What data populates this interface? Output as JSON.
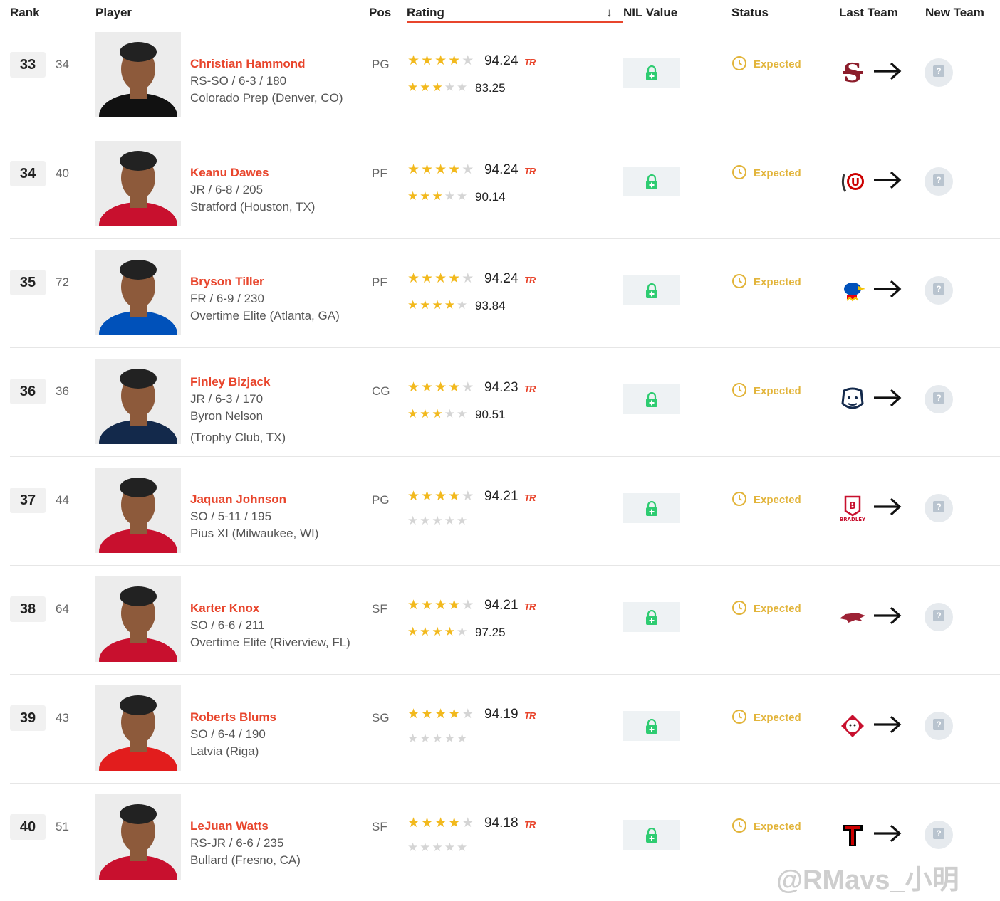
{
  "header": {
    "rank": "Rank",
    "player": "Player",
    "pos": "Pos",
    "rating": "Rating",
    "sort_arrow": "↓",
    "nil": "NIL Value",
    "status": "Status",
    "last_team": "Last Team",
    "new_team": "New Team"
  },
  "colors": {
    "accent": "#e8452c",
    "star": "#f2b91d",
    "status": "#e2b43a",
    "lock": "#2ecc71"
  },
  "rows": [
    {
      "rank": "33",
      "prev": "34",
      "name": "Christian Hammond",
      "info1": "RS-SO / 6-3 / 180",
      "info2": "Colorado Prep (Denver, CO)",
      "info3": "",
      "pos": "PG",
      "tr_stars": 4,
      "tr_score": "94.24",
      "tr_label": "TR",
      "hs_stars": 3,
      "hs_score": "83.25",
      "status": "Expected",
      "last_team_icon": "santa-clara-logo",
      "new_team_icon": "unknown-team-icon"
    },
    {
      "rank": "34",
      "prev": "40",
      "name": "Keanu Dawes",
      "info1": "JR / 6-8 / 205",
      "info2": "Stratford (Houston, TX)",
      "info3": "",
      "pos": "PF",
      "tr_stars": 4,
      "tr_score": "94.24",
      "tr_label": "TR",
      "hs_stars": 3,
      "hs_score": "90.14",
      "status": "Expected",
      "last_team_icon": "utah-logo",
      "new_team_icon": "unknown-team-icon"
    },
    {
      "rank": "35",
      "prev": "72",
      "name": "Bryson Tiller",
      "info1": "FR / 6-9 / 230",
      "info2": "Overtime Elite (Atlanta, GA)",
      "info3": "",
      "pos": "PF",
      "tr_stars": 4,
      "tr_score": "94.24",
      "tr_label": "TR",
      "hs_stars": 4,
      "hs_score": "93.84",
      "status": "Expected",
      "last_team_icon": "kansas-logo",
      "new_team_icon": "unknown-team-icon"
    },
    {
      "rank": "36",
      "prev": "36",
      "name": "Finley Bizjack",
      "info1": "JR / 6-3 / 170",
      "info2": "Byron Nelson",
      "info3": "(Trophy Club, TX)",
      "pos": "CG",
      "tr_stars": 4,
      "tr_score": "94.23",
      "tr_label": "TR",
      "hs_stars": 3,
      "hs_score": "90.51",
      "status": "Expected",
      "last_team_icon": "butler-logo",
      "new_team_icon": "unknown-team-icon"
    },
    {
      "rank": "37",
      "prev": "44",
      "name": "Jaquan Johnson",
      "info1": "SO / 5-11 / 195",
      "info2": "Pius XI (Milwaukee, WI)",
      "info3": "",
      "pos": "PG",
      "tr_stars": 4,
      "tr_score": "94.21",
      "tr_label": "TR",
      "hs_stars": 0,
      "hs_score": "",
      "status": "Expected",
      "last_team_icon": "bradley-logo",
      "new_team_icon": "unknown-team-icon"
    },
    {
      "rank": "38",
      "prev": "64",
      "name": "Karter Knox",
      "info1": "SO / 6-6 / 211",
      "info2": "Overtime Elite (Riverview, FL)",
      "info3": "",
      "pos": "SF",
      "tr_stars": 4,
      "tr_score": "94.21",
      "tr_label": "TR",
      "hs_stars": 4,
      "hs_score": "97.25",
      "status": "Expected",
      "last_team_icon": "arkansas-logo",
      "new_team_icon": "unknown-team-icon"
    },
    {
      "rank": "39",
      "prev": "43",
      "name": "Roberts Blums",
      "info1": "SO / 6-4 / 190",
      "info2": "Latvia (Riga)",
      "info3": "",
      "pos": "SG",
      "tr_stars": 4,
      "tr_score": "94.19",
      "tr_label": "TR",
      "hs_stars": 0,
      "hs_score": "",
      "status": "Expected",
      "last_team_icon": "davidson-logo",
      "new_team_icon": "unknown-team-icon"
    },
    {
      "rank": "40",
      "prev": "51",
      "name": "LeJuan Watts",
      "info1": "RS-JR / 6-6 / 235",
      "info2": "Bullard (Fresno, CA)",
      "info3": "",
      "pos": "SF",
      "tr_stars": 4,
      "tr_score": "94.18",
      "tr_label": "TR",
      "hs_stars": 0,
      "hs_score": "",
      "status": "Expected",
      "last_team_icon": "texas-tech-logo",
      "new_team_icon": "unknown-team-icon"
    }
  ],
  "watermark": "@RMavs_小明"
}
